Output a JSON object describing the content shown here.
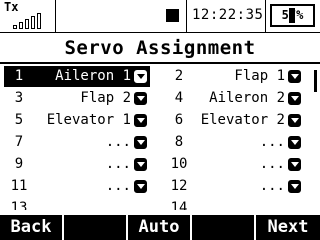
{
  "status": {
    "tx_label": "Tx",
    "signal_icon": "signal-strength-icon",
    "time": "12:22:35",
    "battery_text": "57%",
    "battery_level": 0.57
  },
  "title": "Servo Assignment",
  "servos": [
    {
      "num": "1",
      "function": "Aileron 1",
      "selected": true
    },
    {
      "num": "2",
      "function": "Flap 1"
    },
    {
      "num": "3",
      "function": "Flap 2"
    },
    {
      "num": "4",
      "function": "Aileron 2"
    },
    {
      "num": "5",
      "function": "Elevator 1"
    },
    {
      "num": "6",
      "function": "Elevator 2"
    },
    {
      "num": "7",
      "function": "..."
    },
    {
      "num": "8",
      "function": "..."
    },
    {
      "num": "9",
      "function": "..."
    },
    {
      "num": "10",
      "function": "..."
    },
    {
      "num": "11",
      "function": "..."
    },
    {
      "num": "12",
      "function": "..."
    },
    {
      "num": "13",
      "function": ""
    },
    {
      "num": "14",
      "function": ""
    }
  ],
  "softkeys": {
    "back": "Back",
    "key2": "",
    "auto": "Auto",
    "key4": "",
    "next": "Next"
  }
}
